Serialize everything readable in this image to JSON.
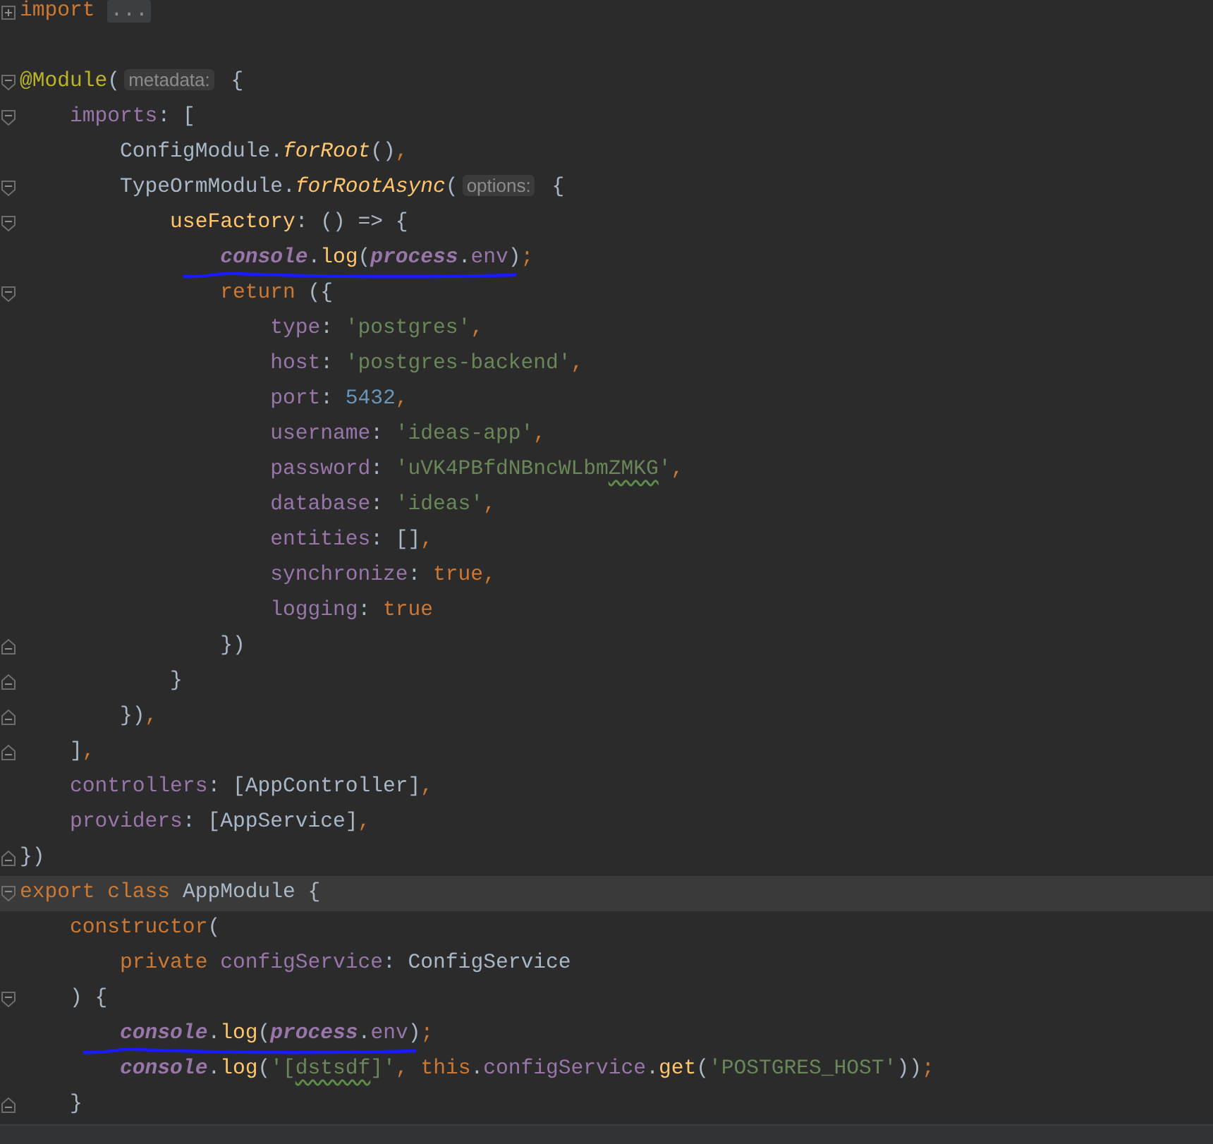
{
  "editor": {
    "lines": [
      {
        "collapsed": true,
        "fold_start": false,
        "fold_end": false,
        "current": false,
        "underlined": false,
        "tokens": [
          {
            "kind": "keyword",
            "text": "import"
          },
          {
            "kind": "folded",
            "text": "..."
          }
        ]
      },
      {
        "collapsed": false,
        "fold_start": false,
        "fold_end": false,
        "current": false,
        "underlined": false
      },
      {
        "collapsed": false,
        "fold_start": true,
        "fold_end": false,
        "current": false,
        "underlined": false,
        "tokens": [
          {
            "kind": "decorator",
            "text": "@Module"
          },
          {
            "kind": "plain",
            "text": "("
          },
          {
            "kind": "hint",
            "text": "metadata:"
          },
          {
            "kind": "plain",
            "text": " {"
          }
        ]
      },
      {
        "collapsed": false,
        "fold_start": true,
        "fold_end": false,
        "current": false,
        "underlined": false,
        "tokens": [
          {
            "kind": "property",
            "text": "    imports"
          },
          {
            "kind": "plain",
            "text": ": ["
          }
        ]
      },
      {
        "collapsed": false,
        "fold_start": false,
        "fold_end": false,
        "current": false,
        "underlined": false,
        "tokens": [
          {
            "kind": "plain",
            "text": "        ConfigModule."
          },
          {
            "kind": "call_italic",
            "text": "forRoot"
          },
          {
            "kind": "plain",
            "text": "()"
          },
          {
            "kind": "punct",
            "text": ","
          }
        ]
      },
      {
        "collapsed": false,
        "fold_start": true,
        "fold_end": false,
        "current": false,
        "underlined": false,
        "tokens": [
          {
            "kind": "plain",
            "text": "        TypeOrmModule."
          },
          {
            "kind": "call_italic",
            "text": "forRootAsync"
          },
          {
            "kind": "plain",
            "text": "("
          },
          {
            "kind": "hint",
            "text": "options:"
          },
          {
            "kind": "plain",
            "text": " {"
          }
        ]
      },
      {
        "collapsed": false,
        "fold_start": true,
        "fold_end": false,
        "current": false,
        "underlined": false,
        "tokens": [
          {
            "kind": "method",
            "text": "            useFactory"
          },
          {
            "kind": "plain",
            "text": ": () => {"
          }
        ]
      },
      {
        "collapsed": false,
        "fold_start": false,
        "fold_end": false,
        "current": false,
        "underlined": true,
        "tokens": [
          {
            "kind": "global",
            "text": "                console"
          },
          {
            "kind": "plain",
            "text": "."
          },
          {
            "kind": "method",
            "text": "log"
          },
          {
            "kind": "plain",
            "text": "("
          },
          {
            "kind": "global",
            "text": "process"
          },
          {
            "kind": "plain",
            "text": "."
          },
          {
            "kind": "property",
            "text": "env"
          },
          {
            "kind": "plain",
            "text": ")"
          },
          {
            "kind": "punct",
            "text": ";"
          }
        ]
      },
      {
        "collapsed": false,
        "fold_start": true,
        "fold_end": false,
        "current": false,
        "underlined": false,
        "tokens": [
          {
            "kind": "keyword",
            "text": "                return"
          },
          {
            "kind": "plain",
            "text": " ({"
          }
        ]
      },
      {
        "collapsed": false,
        "fold_start": false,
        "fold_end": false,
        "current": false,
        "underlined": false,
        "tokens": [
          {
            "kind": "property",
            "text": "                    type"
          },
          {
            "kind": "plain",
            "text": ": "
          },
          {
            "kind": "string",
            "text": "'postgres'"
          },
          {
            "kind": "punct",
            "text": ","
          }
        ]
      },
      {
        "collapsed": false,
        "fold_start": false,
        "fold_end": false,
        "current": false,
        "underlined": false,
        "tokens": [
          {
            "kind": "property",
            "text": "                    host"
          },
          {
            "kind": "plain",
            "text": ": "
          },
          {
            "kind": "string",
            "text": "'postgres-backend'"
          },
          {
            "kind": "punct",
            "text": ","
          }
        ]
      },
      {
        "collapsed": false,
        "fold_start": false,
        "fold_end": false,
        "current": false,
        "underlined": false,
        "tokens": [
          {
            "kind": "property",
            "text": "                    port"
          },
          {
            "kind": "plain",
            "text": ": "
          },
          {
            "kind": "number",
            "text": "5432"
          },
          {
            "kind": "punct",
            "text": ","
          }
        ]
      },
      {
        "collapsed": false,
        "fold_start": false,
        "fold_end": false,
        "current": false,
        "underlined": false,
        "tokens": [
          {
            "kind": "property",
            "text": "                    username"
          },
          {
            "kind": "plain",
            "text": ": "
          },
          {
            "kind": "string",
            "text": "'ideas-app'"
          },
          {
            "kind": "punct",
            "text": ","
          }
        ]
      },
      {
        "collapsed": false,
        "fold_start": false,
        "fold_end": false,
        "current": false,
        "underlined": false,
        "tokens": [
          {
            "kind": "property",
            "text": "                    password"
          },
          {
            "kind": "plain",
            "text": ": "
          },
          {
            "kind": "string",
            "text": "'uVK4PBfdNBncWLbm"
          },
          {
            "kind": "string",
            "text": "ZMKG",
            "typo": true
          },
          {
            "kind": "string",
            "text": "'"
          },
          {
            "kind": "punct",
            "text": ","
          }
        ]
      },
      {
        "collapsed": false,
        "fold_start": false,
        "fold_end": false,
        "current": false,
        "underlined": false,
        "tokens": [
          {
            "kind": "property",
            "text": "                    database"
          },
          {
            "kind": "plain",
            "text": ": "
          },
          {
            "kind": "string",
            "text": "'ideas'"
          },
          {
            "kind": "punct",
            "text": ","
          }
        ]
      },
      {
        "collapsed": false,
        "fold_start": false,
        "fold_end": false,
        "current": false,
        "underlined": false,
        "tokens": [
          {
            "kind": "property",
            "text": "                    entities"
          },
          {
            "kind": "plain",
            "text": ": []"
          },
          {
            "kind": "punct",
            "text": ","
          }
        ]
      },
      {
        "collapsed": false,
        "fold_start": false,
        "fold_end": false,
        "current": false,
        "underlined": false,
        "tokens": [
          {
            "kind": "property",
            "text": "                    synchronize"
          },
          {
            "kind": "plain",
            "text": ": "
          },
          {
            "kind": "keyword",
            "text": "true"
          },
          {
            "kind": "punct",
            "text": ","
          }
        ]
      },
      {
        "collapsed": false,
        "fold_start": false,
        "fold_end": false,
        "current": false,
        "underlined": false,
        "tokens": [
          {
            "kind": "property",
            "text": "                    logging"
          },
          {
            "kind": "plain",
            "text": ": "
          },
          {
            "kind": "keyword",
            "text": "true"
          }
        ]
      },
      {
        "collapsed": false,
        "fold_start": false,
        "fold_end": true,
        "current": false,
        "underlined": false,
        "tokens": [
          {
            "kind": "plain",
            "text": "                })"
          }
        ]
      },
      {
        "collapsed": false,
        "fold_start": false,
        "fold_end": true,
        "current": false,
        "underlined": false,
        "tokens": [
          {
            "kind": "plain",
            "text": "            }"
          }
        ]
      },
      {
        "collapsed": false,
        "fold_start": false,
        "fold_end": true,
        "current": false,
        "underlined": false,
        "tokens": [
          {
            "kind": "plain",
            "text": "        })"
          },
          {
            "kind": "punct",
            "text": ","
          }
        ]
      },
      {
        "collapsed": false,
        "fold_start": false,
        "fold_end": true,
        "current": false,
        "underlined": false,
        "tokens": [
          {
            "kind": "plain",
            "text": "    ]"
          },
          {
            "kind": "punct",
            "text": ","
          }
        ]
      },
      {
        "collapsed": false,
        "fold_start": false,
        "fold_end": false,
        "current": false,
        "underlined": false,
        "tokens": [
          {
            "kind": "property",
            "text": "    controllers"
          },
          {
            "kind": "plain",
            "text": ": [AppController]"
          },
          {
            "kind": "punct",
            "text": ","
          }
        ]
      },
      {
        "collapsed": false,
        "fold_start": false,
        "fold_end": false,
        "current": false,
        "underlined": false,
        "tokens": [
          {
            "kind": "property",
            "text": "    providers"
          },
          {
            "kind": "plain",
            "text": ": [AppService]"
          },
          {
            "kind": "punct",
            "text": ","
          }
        ]
      },
      {
        "collapsed": false,
        "fold_start": false,
        "fold_end": true,
        "current": false,
        "underlined": false,
        "tokens": [
          {
            "kind": "plain",
            "text": "})"
          }
        ]
      },
      {
        "collapsed": false,
        "fold_start": true,
        "fold_end": false,
        "current": true,
        "underlined": false,
        "tokens": [
          {
            "kind": "keyword",
            "text": "export class"
          },
          {
            "kind": "plain",
            "text": " AppModule {"
          }
        ]
      },
      {
        "collapsed": false,
        "fold_start": false,
        "fold_end": false,
        "current": false,
        "underlined": false,
        "tokens": [
          {
            "kind": "keyword",
            "text": "    constructor"
          },
          {
            "kind": "plain",
            "text": "("
          }
        ]
      },
      {
        "collapsed": false,
        "fold_start": false,
        "fold_end": false,
        "current": false,
        "underlined": false,
        "tokens": [
          {
            "kind": "keyword",
            "text": "        private"
          },
          {
            "kind": "property",
            "text": " configService"
          },
          {
            "kind": "plain",
            "text": ": ConfigService"
          }
        ]
      },
      {
        "collapsed": false,
        "fold_start": true,
        "fold_end": false,
        "current": false,
        "underlined": false,
        "tokens": [
          {
            "kind": "plain",
            "text": "    ) {"
          }
        ]
      },
      {
        "collapsed": false,
        "fold_start": false,
        "fold_end": false,
        "current": false,
        "underlined": true,
        "tokens": [
          {
            "kind": "global",
            "text": "        console"
          },
          {
            "kind": "plain",
            "text": "."
          },
          {
            "kind": "method",
            "text": "log"
          },
          {
            "kind": "plain",
            "text": "("
          },
          {
            "kind": "global",
            "text": "process"
          },
          {
            "kind": "plain",
            "text": "."
          },
          {
            "kind": "property",
            "text": "env"
          },
          {
            "kind": "plain",
            "text": ")"
          },
          {
            "kind": "punct",
            "text": ";"
          }
        ]
      },
      {
        "collapsed": false,
        "fold_start": false,
        "fold_end": false,
        "current": false,
        "underlined": false,
        "tokens": [
          {
            "kind": "global",
            "text": "        console"
          },
          {
            "kind": "plain",
            "text": "."
          },
          {
            "kind": "method",
            "text": "log"
          },
          {
            "kind": "plain",
            "text": "("
          },
          {
            "kind": "string",
            "text": "'["
          },
          {
            "kind": "string",
            "text": "dstsdf",
            "typo": true
          },
          {
            "kind": "string",
            "text": "]'"
          },
          {
            "kind": "punct",
            "text": ", "
          },
          {
            "kind": "keyword",
            "text": "this"
          },
          {
            "kind": "plain",
            "text": "."
          },
          {
            "kind": "property",
            "text": "configService"
          },
          {
            "kind": "plain",
            "text": "."
          },
          {
            "kind": "method",
            "text": "get"
          },
          {
            "kind": "plain",
            "text": "("
          },
          {
            "kind": "string",
            "text": "'POSTGRES_HOST'"
          },
          {
            "kind": "plain",
            "text": "))"
          },
          {
            "kind": "punct",
            "text": ";"
          }
        ]
      },
      {
        "collapsed": false,
        "fold_start": false,
        "fold_end": true,
        "current": false,
        "underlined": false,
        "tokens": [
          {
            "kind": "plain",
            "text": "    }"
          }
        ]
      }
    ]
  }
}
